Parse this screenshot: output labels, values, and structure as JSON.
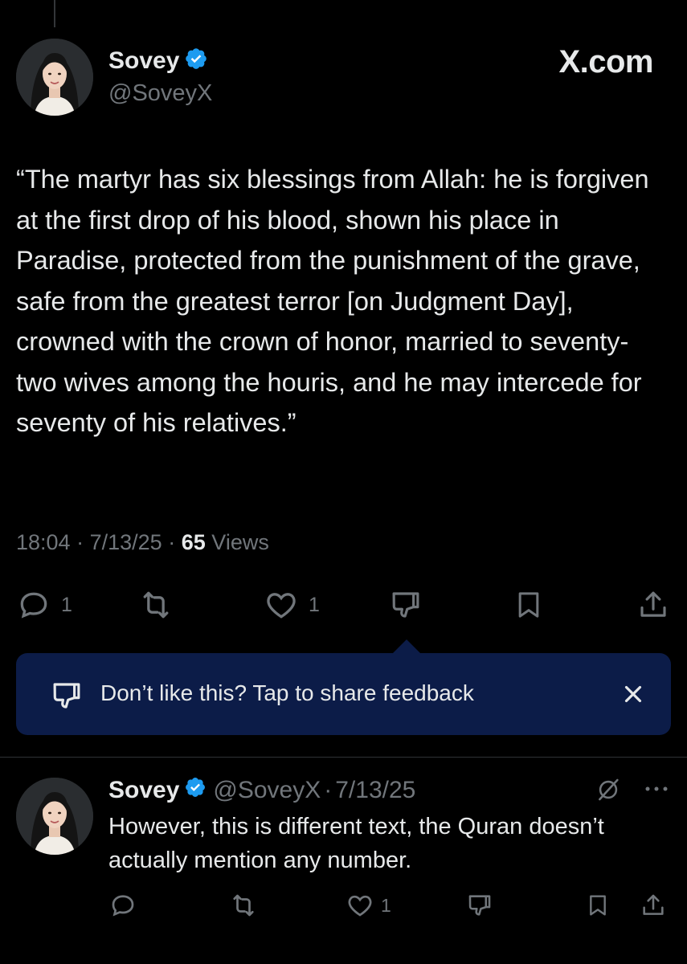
{
  "brand": "X.com",
  "tweet": {
    "author_name": "Sovey",
    "author_handle": "@SoveyX",
    "text": "“The martyr has six blessings from Allah: he is forgiven at the first drop of his blood, shown his place in Paradise, protected from the punishment of the grave, safe from the greatest terror [on Judgment Day], crowned with the crown of honor, married to seventy-two wives among the houris, and he may intercede for seventy of his relatives.”",
    "time": "18:04",
    "date": "7/13/25",
    "views_count": "65",
    "views_label": "Views",
    "reply_count": "1",
    "like_count": "1",
    "separator": "·"
  },
  "tooltip": {
    "text": "Don’t like this? Tap to share feedback"
  },
  "reply": {
    "author_name": "Sovey",
    "author_handle": "@SoveyX",
    "separator": "·",
    "date": "7/13/25",
    "text": "However, this is different text, the Quran doesn’t actually mention any number.",
    "like_count": "1"
  },
  "icons": {
    "verified": "verified-badge-icon",
    "reply": "reply-icon",
    "repost": "repost-icon",
    "like": "heart-icon",
    "dislike": "thumbs-down-icon",
    "bookmark": "bookmark-icon",
    "share": "share-icon",
    "close": "close-icon",
    "grok": "grok-icon",
    "more": "more-icon"
  },
  "colors": {
    "background": "#000000",
    "text": "#e7e9ea",
    "muted": "#71767b",
    "verified": "#1d9bf0",
    "tooltip_bg": "#0c1c48",
    "divider": "#2f3336"
  }
}
